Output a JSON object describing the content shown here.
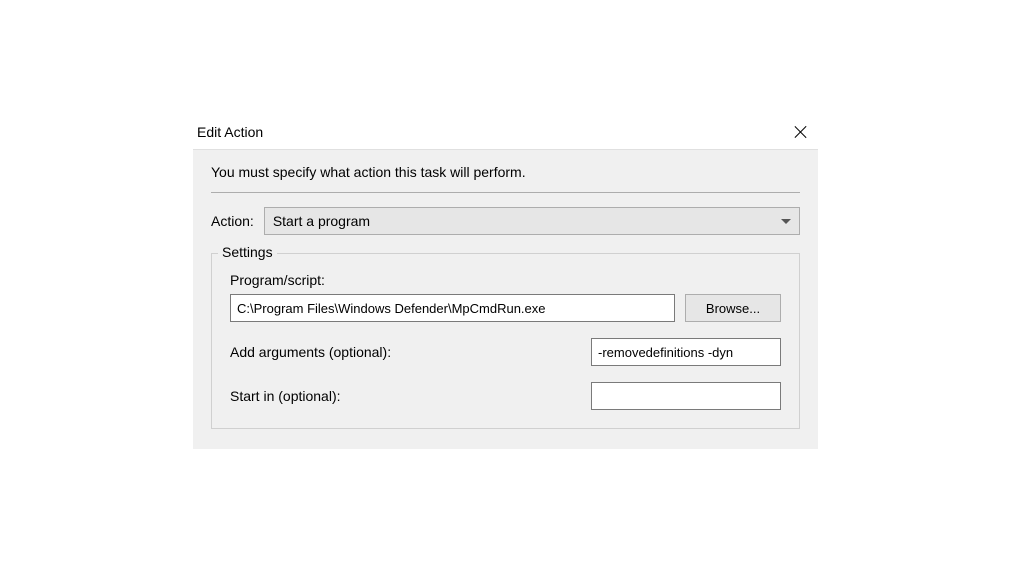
{
  "dialog": {
    "title": "Edit Action",
    "instruction": "You must specify what action this task will perform.",
    "action": {
      "label": "Action:",
      "selected": "Start a program"
    },
    "settings": {
      "legend": "Settings",
      "program": {
        "label": "Program/script:",
        "value": "C:\\Program Files\\Windows Defender\\MpCmdRun.exe",
        "browse_label": "Browse..."
      },
      "arguments": {
        "label": "Add arguments (optional):",
        "value": "-removedefinitions -dyn"
      },
      "start_in": {
        "label": "Start in (optional):",
        "value": ""
      }
    }
  }
}
